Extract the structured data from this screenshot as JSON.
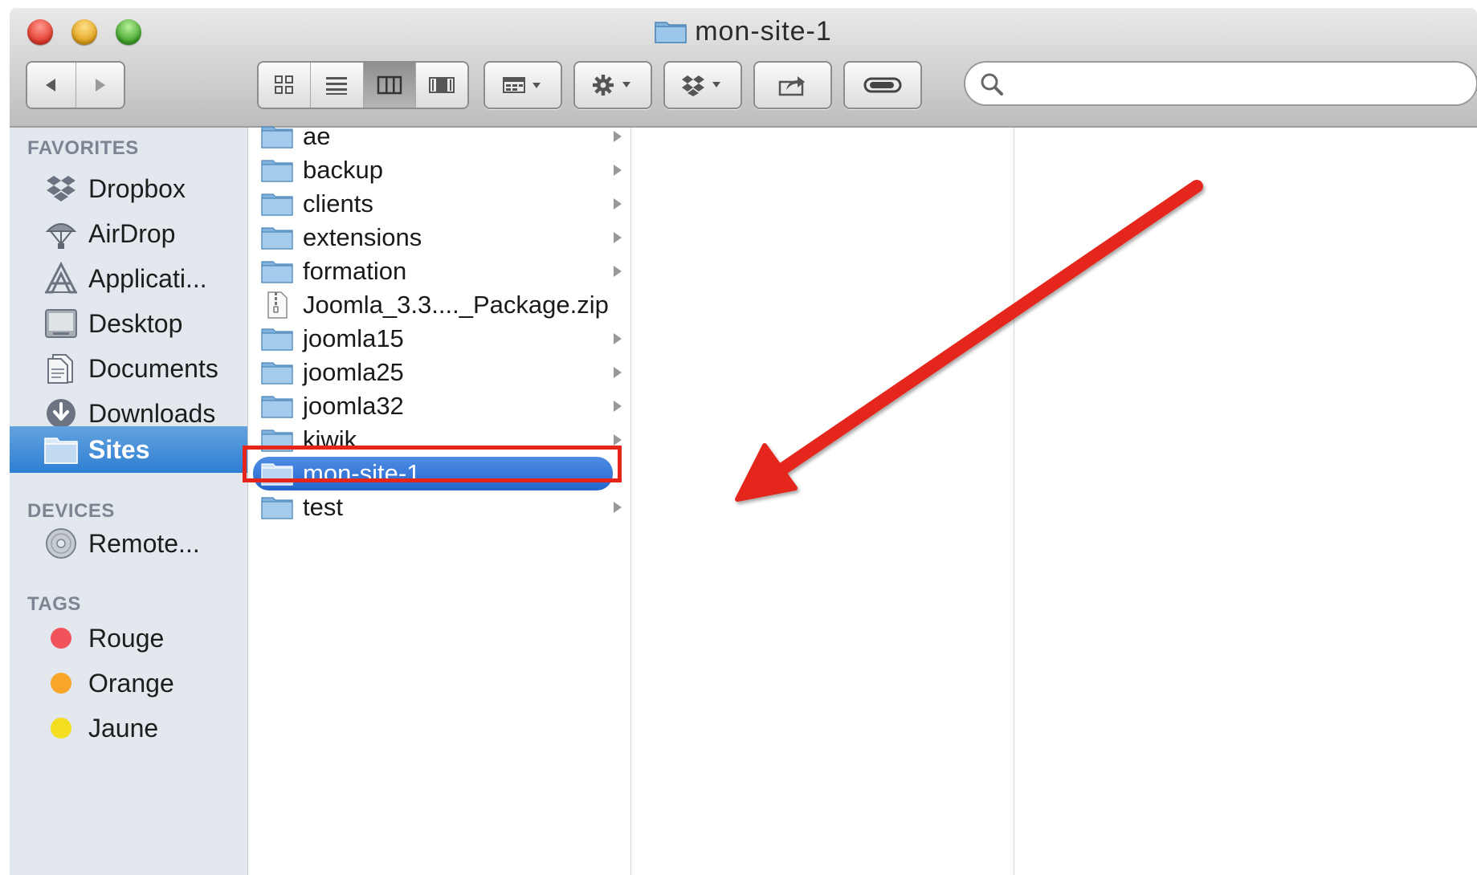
{
  "window": {
    "title": "mon-site-1"
  },
  "toolbar": {
    "nav": [
      "back-arrow",
      "forward-arrow"
    ],
    "view_modes": [
      "icon-view",
      "list-view",
      "column-view",
      "coverflow-view"
    ],
    "active_view": "column-view",
    "buttons": [
      "arrange-menu",
      "action-gear-menu",
      "dropbox-menu",
      "share",
      "tags-toggle"
    ],
    "search": {
      "value": "",
      "placeholder": ""
    }
  },
  "sidebar": {
    "favorites_header": "FAVORITES",
    "favorites": [
      {
        "label": "Dropbox",
        "icon": "dropbox-icon"
      },
      {
        "label": "AirDrop",
        "icon": "airdrop-icon"
      },
      {
        "label": "Applicati...",
        "icon": "applications-icon"
      },
      {
        "label": "Desktop",
        "icon": "desktop-icon"
      },
      {
        "label": "Documents",
        "icon": "documents-icon"
      },
      {
        "label": "Downloads",
        "icon": "downloads-icon"
      },
      {
        "label": "Sites",
        "icon": "folder-icon",
        "selected": true
      }
    ],
    "devices_header": "DEVICES",
    "devices": [
      {
        "label": "Remote...",
        "icon": "remote-disc-icon"
      }
    ],
    "tags_header": "TAGS",
    "tags": [
      {
        "label": "Rouge",
        "color": "#f0545a"
      },
      {
        "label": "Orange",
        "color": "#f8a62a"
      },
      {
        "label": "Jaune",
        "color": "#f3de22"
      }
    ]
  },
  "column1": {
    "items": [
      {
        "name": "ae",
        "type": "folder"
      },
      {
        "name": "backup",
        "type": "folder"
      },
      {
        "name": "clients",
        "type": "folder"
      },
      {
        "name": "extensions",
        "type": "folder"
      },
      {
        "name": "formation",
        "type": "folder"
      },
      {
        "name": "Joomla_3.3...._Package.zip",
        "type": "zip"
      },
      {
        "name": "joomla15",
        "type": "folder"
      },
      {
        "name": "joomla25",
        "type": "folder"
      },
      {
        "name": "joomla32",
        "type": "folder"
      },
      {
        "name": "kiwik",
        "type": "folder"
      },
      {
        "name": "mon-site-1",
        "type": "folder",
        "selected": true
      },
      {
        "name": "test",
        "type": "folder"
      }
    ]
  },
  "colors": {
    "selection": "#2e7fd4",
    "annotation": "#e5251a",
    "sidebar_bg": "#e3e8ee"
  }
}
